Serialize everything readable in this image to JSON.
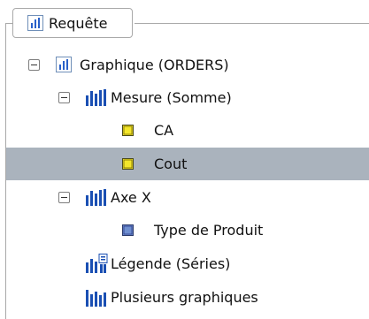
{
  "group": {
    "title": "Requête"
  },
  "tree": {
    "root": {
      "label": "Graphique (ORDERS)"
    },
    "measure": {
      "label": "Mesure (Somme)"
    },
    "measure_items": [
      {
        "label": "CA"
      },
      {
        "label": "Cout"
      }
    ],
    "axis_x": {
      "label": "Axe X"
    },
    "axis_x_items": [
      {
        "label": "Type de Produit"
      }
    ],
    "legend": {
      "label": "Légende (Séries)"
    },
    "multi": {
      "label": "Plusieurs graphiques"
    }
  },
  "icons": {
    "chart": "bar-chart-icon",
    "measure": "measure-bars-icon",
    "field": "field-icon",
    "legend": "legend-icon"
  },
  "colors": {
    "selection": "#aab3bd",
    "field_yellow": "#f3e62a",
    "field_blue": "#6f8fd0",
    "bar_blue": "#1a4fb3"
  },
  "selected_item": "Cout"
}
